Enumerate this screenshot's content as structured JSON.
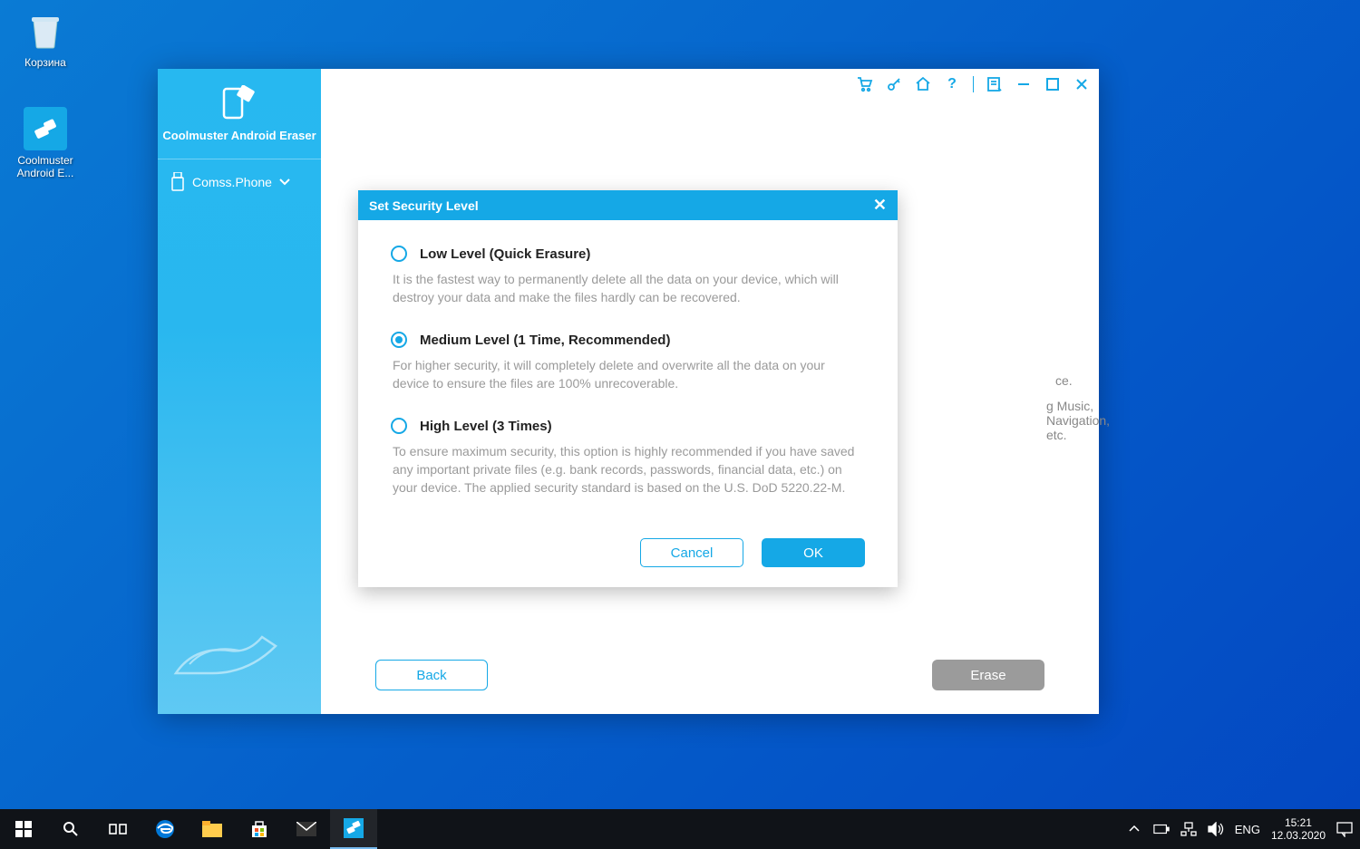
{
  "desktop": {
    "recycle_bin": "Корзина",
    "app_shortcut": "Coolmuster Android E..."
  },
  "app": {
    "title": "Coolmuster Android Eraser",
    "device": "Comss.Phone",
    "footer": {
      "back": "Back",
      "erase": "Erase"
    },
    "background_lines": [
      "ce.",
      "g Music, Navigation, etc."
    ]
  },
  "modal": {
    "title": "Set Security Level",
    "options": [
      {
        "label": "Low Level (Quick Erasure)",
        "desc": "It is the fastest way to permanently delete all the data on your device, which will destroy your data and make the files hardly can be recovered.",
        "selected": false
      },
      {
        "label": "Medium Level (1 Time, Recommended)",
        "desc": "For higher security, it will completely delete and overwrite all the data on your device to ensure the files are 100% unrecoverable.",
        "selected": true
      },
      {
        "label": "High Level (3 Times)",
        "desc": "To ensure maximum security, this option is highly recommended if you have saved any important private files (e.g. bank records, passwords, financial data, etc.) on your device. The applied security standard is based on the U.S. DoD 5220.22-M.",
        "selected": false
      }
    ],
    "cancel": "Cancel",
    "ok": "OK"
  },
  "taskbar": {
    "lang": "ENG",
    "time": "15:21",
    "date": "12.03.2020"
  }
}
